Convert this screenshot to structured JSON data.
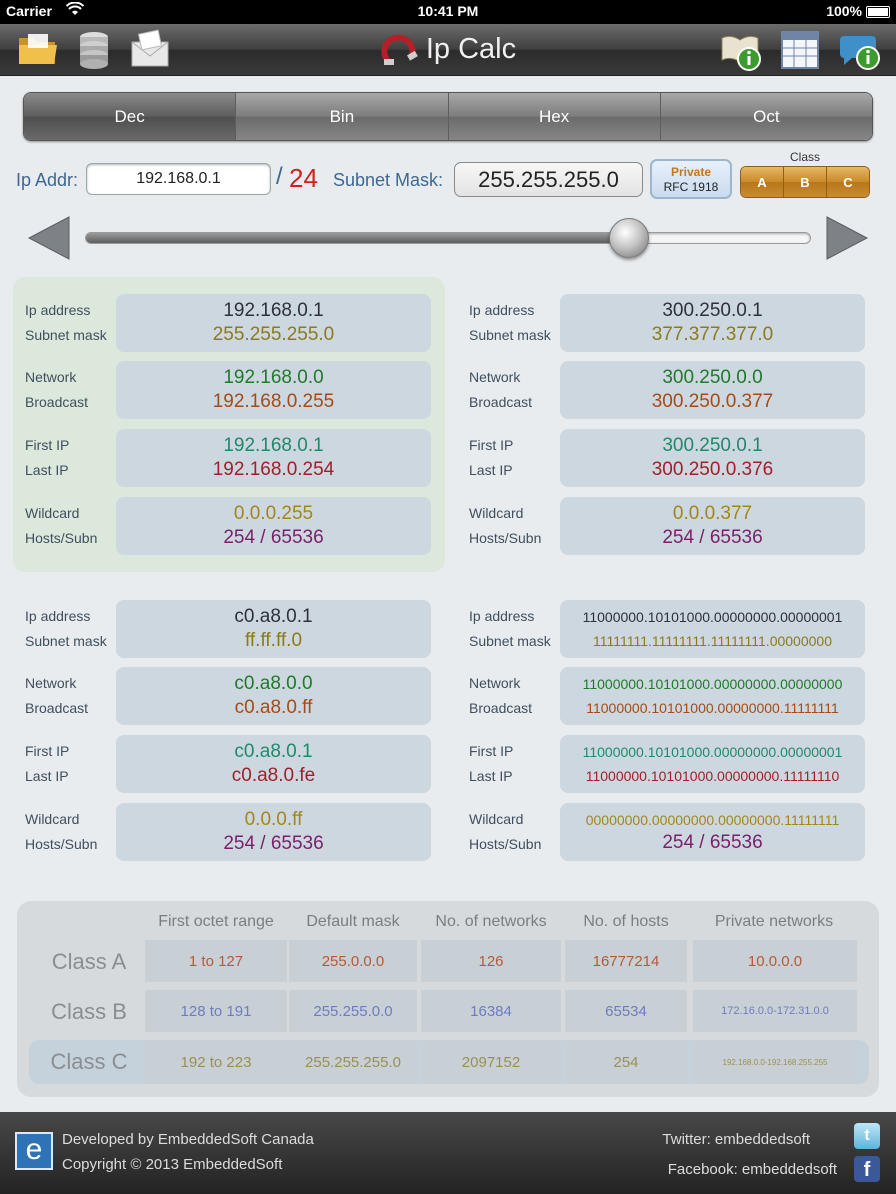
{
  "status": {
    "carrier": "Carrier",
    "time": "10:41 PM",
    "battery": "100%"
  },
  "toolbar": {
    "title": "Ip Calc"
  },
  "tabs": [
    "Dec",
    "Bin",
    "Hex",
    "Oct"
  ],
  "input": {
    "ip_label": "Ip Addr:",
    "ip_value": "192.168.0.1",
    "slash": "/",
    "prefix": "24",
    "mask_label": "Subnet Mask:",
    "mask_value": "255.255.255.0",
    "private_line1": "Private",
    "private_line2": "RFC 1918",
    "class_label": "Class",
    "classes": [
      "A",
      "B",
      "C"
    ]
  },
  "slider": {
    "value": 24,
    "min": 0,
    "max": 32
  },
  "labels": {
    "ip": "Ip address",
    "mask": "Subnet mask",
    "network": "Network",
    "broadcast": "Broadcast",
    "first": "First IP",
    "last": "Last IP",
    "wildcard": "Wildcard",
    "hosts": "Hosts/Subn"
  },
  "dec": {
    "ip": "192.168.0.1",
    "mask": "255.255.255.0",
    "network": "192.168.0.0",
    "broadcast": "192.168.0.255",
    "first": "192.168.0.1",
    "last": "192.168.0.254",
    "wildcard": "0.0.0.255",
    "hosts": "254 / 65536"
  },
  "oct": {
    "ip": "300.250.0.1",
    "mask": "377.377.377.0",
    "network": "300.250.0.0",
    "broadcast": "300.250.0.377",
    "first": "300.250.0.1",
    "last": "300.250.0.376",
    "wildcard": "0.0.0.377",
    "hosts": "254 / 65536"
  },
  "hex": {
    "ip": "c0.a8.0.1",
    "mask": "ff.ff.ff.0",
    "network": "c0.a8.0.0",
    "broadcast": "c0.a8.0.ff",
    "first": "c0.a8.0.1",
    "last": "c0.a8.0.fe",
    "wildcard": "0.0.0.ff",
    "hosts": "254 / 65536"
  },
  "bin": {
    "ip": "11000000.10101000.00000000.00000001",
    "mask": "11111111.11111111.11111111.00000000",
    "network": "11000000.10101000.00000000.00000000",
    "broadcast": "11000000.10101000.00000000.11111111",
    "first": "11000000.10101000.00000000.00000001",
    "last": "11000000.10101000.00000000.11111110",
    "wildcard": "00000000.00000000.00000000.11111111",
    "hosts": "254 / 65536"
  },
  "class_table": {
    "headers": [
      "First octet range",
      "Default mask",
      "No. of networks",
      "No. of hosts",
      "Private networks"
    ],
    "rows": [
      {
        "name": "Class A",
        "range": "1 to 127",
        "mask": "255.0.0.0",
        "networks": "126",
        "hosts": "16777214",
        "private": "10.0.0.0"
      },
      {
        "name": "Class B",
        "range": "128 to 191",
        "mask": "255.255.0.0",
        "networks": "16384",
        "hosts": "65534",
        "private": "172.16.0.0-172.31.0.0"
      },
      {
        "name": "Class C",
        "range": "192 to 223",
        "mask": "255.255.255.0",
        "networks": "2097152",
        "hosts": "254",
        "private": "192.168.0.0-192.168.255.255"
      }
    ]
  },
  "footer": {
    "developer": "Developed by EmbeddedSoft Canada",
    "copyright": "Copyright © 2013 EmbeddedSoft",
    "twitter": "Twitter: embeddedsoft",
    "facebook": "Facebook: embeddedsoft",
    "logo_letter": "e",
    "twitter_letter": "t",
    "facebook_letter": "f"
  }
}
